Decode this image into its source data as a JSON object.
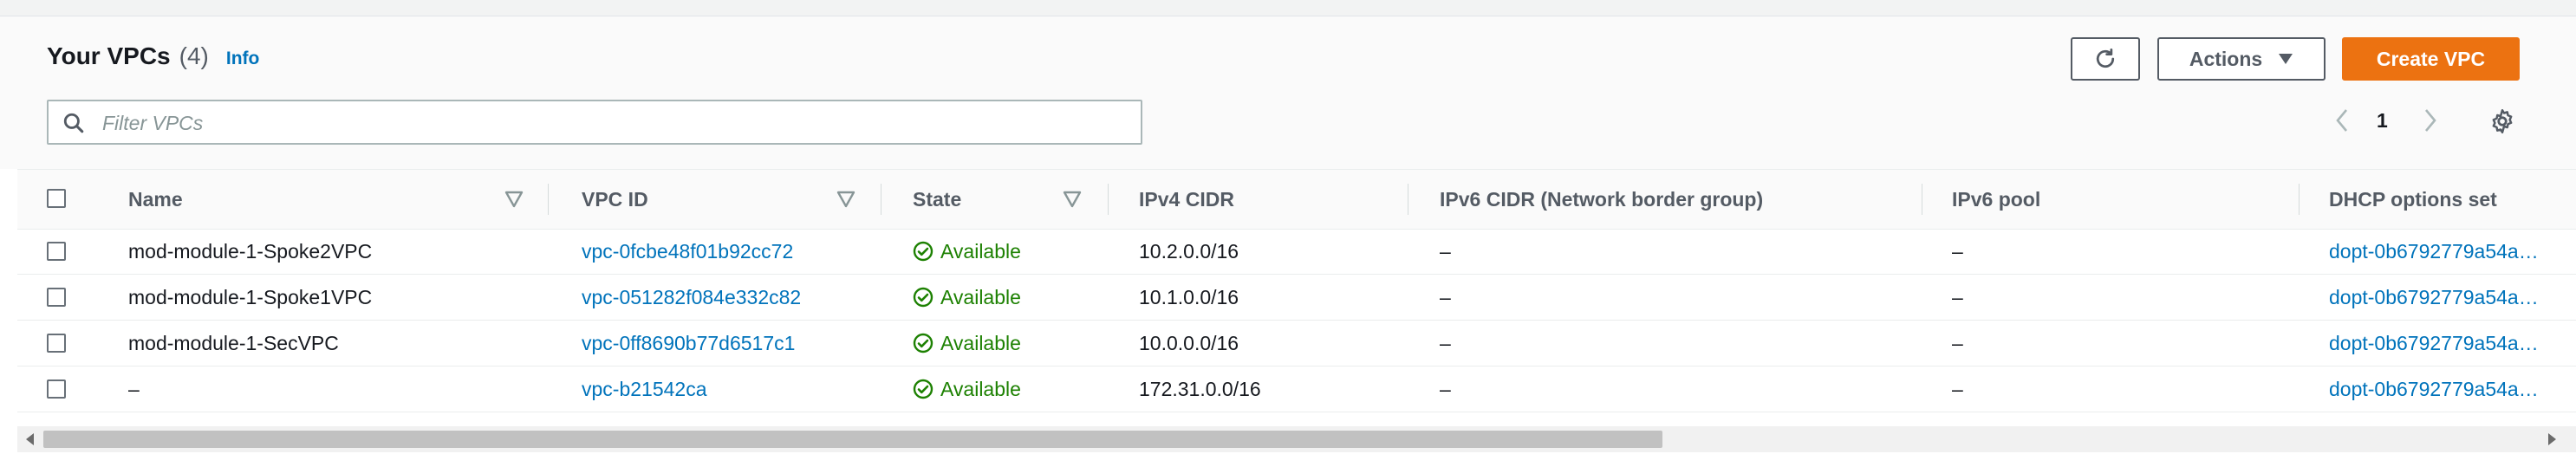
{
  "header": {
    "title": "Your VPCs",
    "count": "(4)",
    "info_label": "Info",
    "actions_label": "Actions",
    "create_label": "Create VPC"
  },
  "search": {
    "placeholder": "Filter VPCs",
    "value": ""
  },
  "pagination": {
    "current_page": "1"
  },
  "icons": {
    "refresh": "refresh-icon",
    "actions_caret": "caret-down-icon",
    "search": "search-icon",
    "prev": "chevron-left-icon",
    "next": "chevron-right-icon",
    "settings": "gear-icon",
    "sort": "sort-descending-icon",
    "status": "check-circle-icon"
  },
  "colors": {
    "accent": "#ec7211",
    "link": "#0073bb",
    "success": "#1d8102",
    "header_bg": "#fafafa"
  },
  "table": {
    "columns": [
      "Name",
      "VPC ID",
      "State",
      "IPv4 CIDR",
      "IPv6 CIDR (Network border group)",
      "IPv6 pool",
      "DHCP options set"
    ],
    "rows": [
      {
        "name": "mod-module-1-Spoke2VPC",
        "vpc_id": "vpc-0fcbe48f01b92cc72",
        "state": "Available",
        "ipv4": "10.2.0.0/16",
        "ipv6": "–",
        "ipv6pool": "–",
        "dhcp": "dopt-0b6792779a54a…"
      },
      {
        "name": "mod-module-1-Spoke1VPC",
        "vpc_id": "vpc-051282f084e332c82",
        "state": "Available",
        "ipv4": "10.1.0.0/16",
        "ipv6": "–",
        "ipv6pool": "–",
        "dhcp": "dopt-0b6792779a54a…"
      },
      {
        "name": "mod-module-1-SecVPC",
        "vpc_id": "vpc-0ff8690b77d6517c1",
        "state": "Available",
        "ipv4": "10.0.0.0/16",
        "ipv6": "–",
        "ipv6pool": "–",
        "dhcp": "dopt-0b6792779a54a…"
      },
      {
        "name": "–",
        "vpc_id": "vpc-b21542ca",
        "state": "Available",
        "ipv4": "172.31.0.0/16",
        "ipv6": "–",
        "ipv6pool": "–",
        "dhcp": "dopt-0b6792779a54a…"
      }
    ]
  }
}
